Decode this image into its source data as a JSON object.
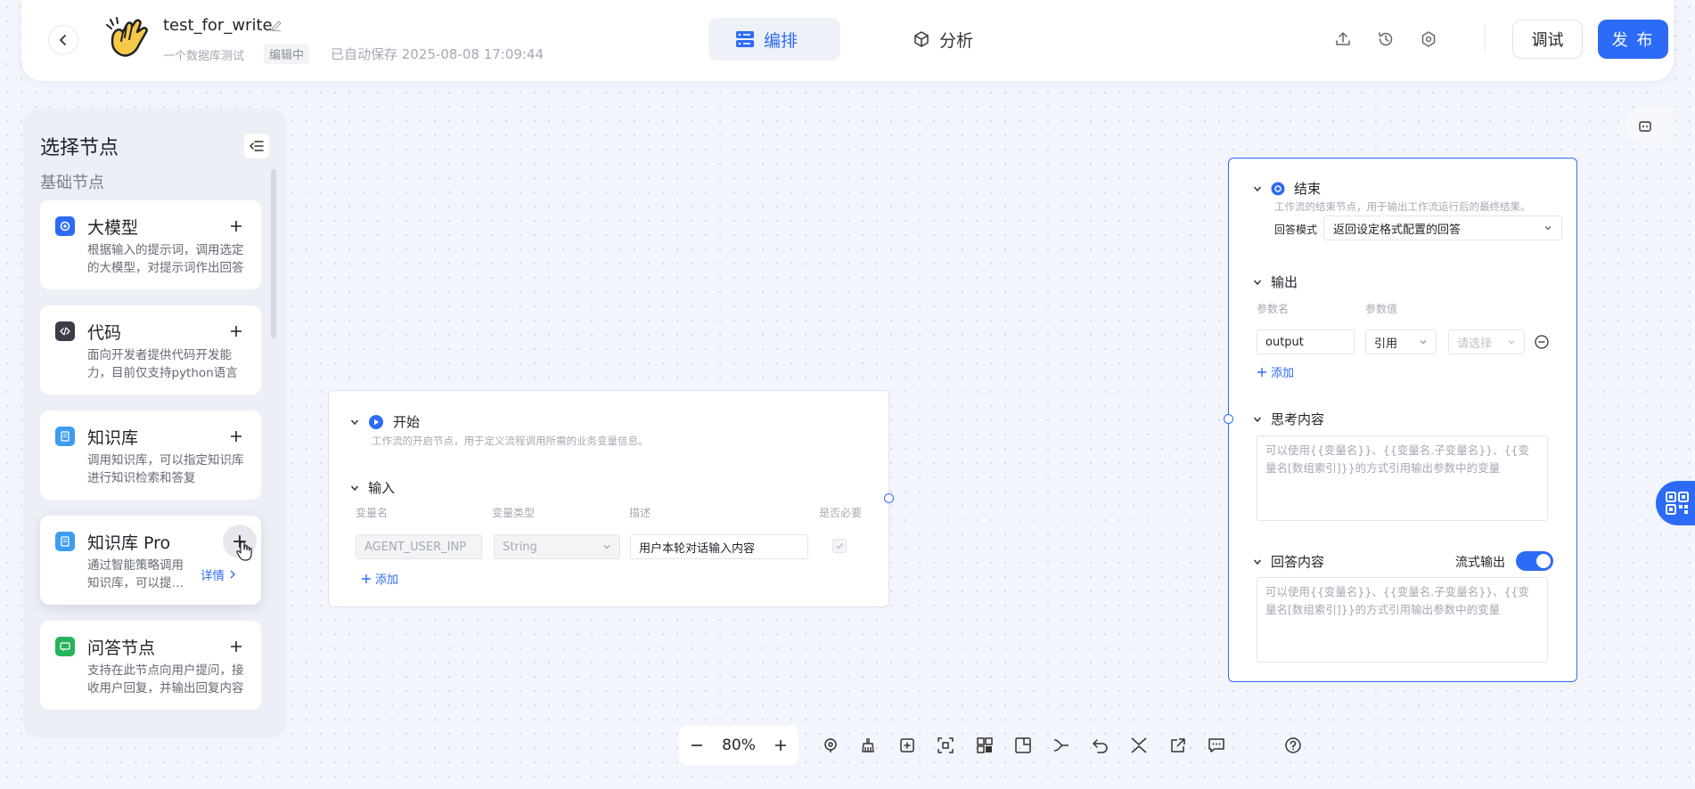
{
  "header": {
    "app_name": "test_for_write",
    "app_description": "一个数据库测试",
    "edit_badge": "编辑中",
    "save_status": "已自动保存 2025-08-08 17:09:44",
    "tabs": [
      {
        "label": "编排",
        "icon": "layout-icon",
        "active": true
      },
      {
        "label": "分析",
        "icon": "cube-icon",
        "active": false
      }
    ],
    "icons": [
      "upload-icon",
      "history-icon",
      "settings-icon"
    ],
    "debug_label": "调试",
    "publish_label": "发 布"
  },
  "left_panel": {
    "title": "选择节点",
    "section": "基础节点",
    "nodes": [
      {
        "name": "大模型",
        "desc": "根据输入的提示词，调用选定的大模型，对提示词作出回答",
        "icon": "llm-icon"
      },
      {
        "name": "代码",
        "desc": "面向开发者提供代码开发能力，目前仅支持python语言",
        "icon": "code-icon"
      },
      {
        "name": "知识库",
        "desc": "调用知识库，可以指定知识库进行知识检索和答复",
        "icon": "knowledge-icon"
      },
      {
        "name": "知识库 Pro",
        "desc": "通过智能策略调用知识库，可以提供更好的效果",
        "icon": "knowledge-pro-icon",
        "detail": "详情"
      },
      {
        "name": "问答节点",
        "desc": "支持在此节点向用户提问，接收用户回复，并输出回复内容",
        "icon": "qa-icon"
      }
    ]
  },
  "start_node": {
    "title": "开始",
    "desc": "工作流的开启节点，用于定义流程调用所需的业务变量信息。",
    "input_label": "输入",
    "columns": [
      "变量名",
      "变量类型",
      "描述",
      "是否必要"
    ],
    "row": {
      "name": "AGENT_USER_INP",
      "type": "String",
      "desc": "用户本轮对话输入内容",
      "required": true
    },
    "add_label": "添加"
  },
  "end_node": {
    "title": "结束",
    "desc": "工作流的结束节点，用于输出工作流运行后的最终结果。",
    "mode_label": "回答模式",
    "mode_value": "返回设定格式配置的回答",
    "output_label": "输出",
    "columns": [
      "参数名",
      "参数值"
    ],
    "row": {
      "name": "output",
      "ref": "引用",
      "placeholder": "请选择"
    },
    "add_label": "添加",
    "thinking_label": "思考内容",
    "answer_label": "回答内容",
    "stream_label": "流式输出",
    "stream_on": true,
    "textarea_placeholder": "可以使用{{变量名}}、{{变量名.子变量名}}、{{变量名[数组索引]}}的方式引用输出参数中的变量"
  },
  "toolbar": {
    "zoom": "80%",
    "icons": [
      "locate-icon",
      "clean-icon",
      "add-note-icon",
      "fit-view-icon",
      "layout-icon",
      "minimap-icon",
      "connector-icon",
      "undo-icon",
      "collapse-icon",
      "export-icon",
      "comment-icon",
      "help-icon"
    ]
  },
  "colors": {
    "accent": "#2d6bf7",
    "canvas": "#f2f5fb"
  }
}
